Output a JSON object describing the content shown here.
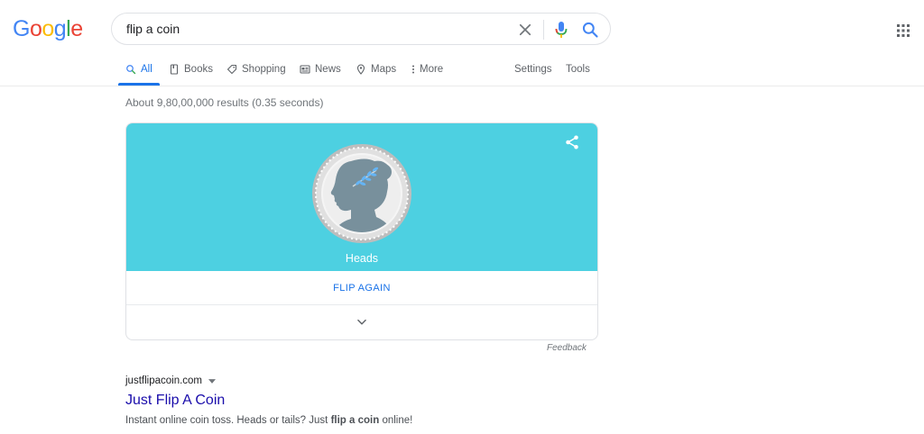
{
  "logo": {
    "letters": [
      "G",
      "o",
      "o",
      "g",
      "l",
      "e"
    ],
    "colors": [
      "#4285f4",
      "#ea4335",
      "#fbbc05",
      "#4285f4",
      "#34a853",
      "#ea4335"
    ]
  },
  "search": {
    "query": "flip a coin"
  },
  "tabs": [
    {
      "label": "All",
      "icon": "search-icon",
      "active": true
    },
    {
      "label": "Books",
      "icon": "book-icon"
    },
    {
      "label": "Shopping",
      "icon": "tag-icon"
    },
    {
      "label": "News",
      "icon": "news-icon"
    },
    {
      "label": "Maps",
      "icon": "map-pin-icon"
    },
    {
      "label": "More",
      "icon": "more-vert-icon"
    }
  ],
  "tools": {
    "settings": "Settings",
    "tools": "Tools"
  },
  "result_stats": "About 9,80,00,000 results (0.35 seconds)",
  "coin_widget": {
    "result": "Heads",
    "flip_again": "FLIP AGAIN",
    "feedback": "Feedback",
    "bg_color": "#4dd0e1"
  },
  "result1": {
    "url": "justflipacoin.com",
    "title": "Just Flip A Coin",
    "snippet_pre": "Instant online coin toss. Heads or tails? Just ",
    "snippet_bold": "flip a coin",
    "snippet_post": " online!"
  }
}
